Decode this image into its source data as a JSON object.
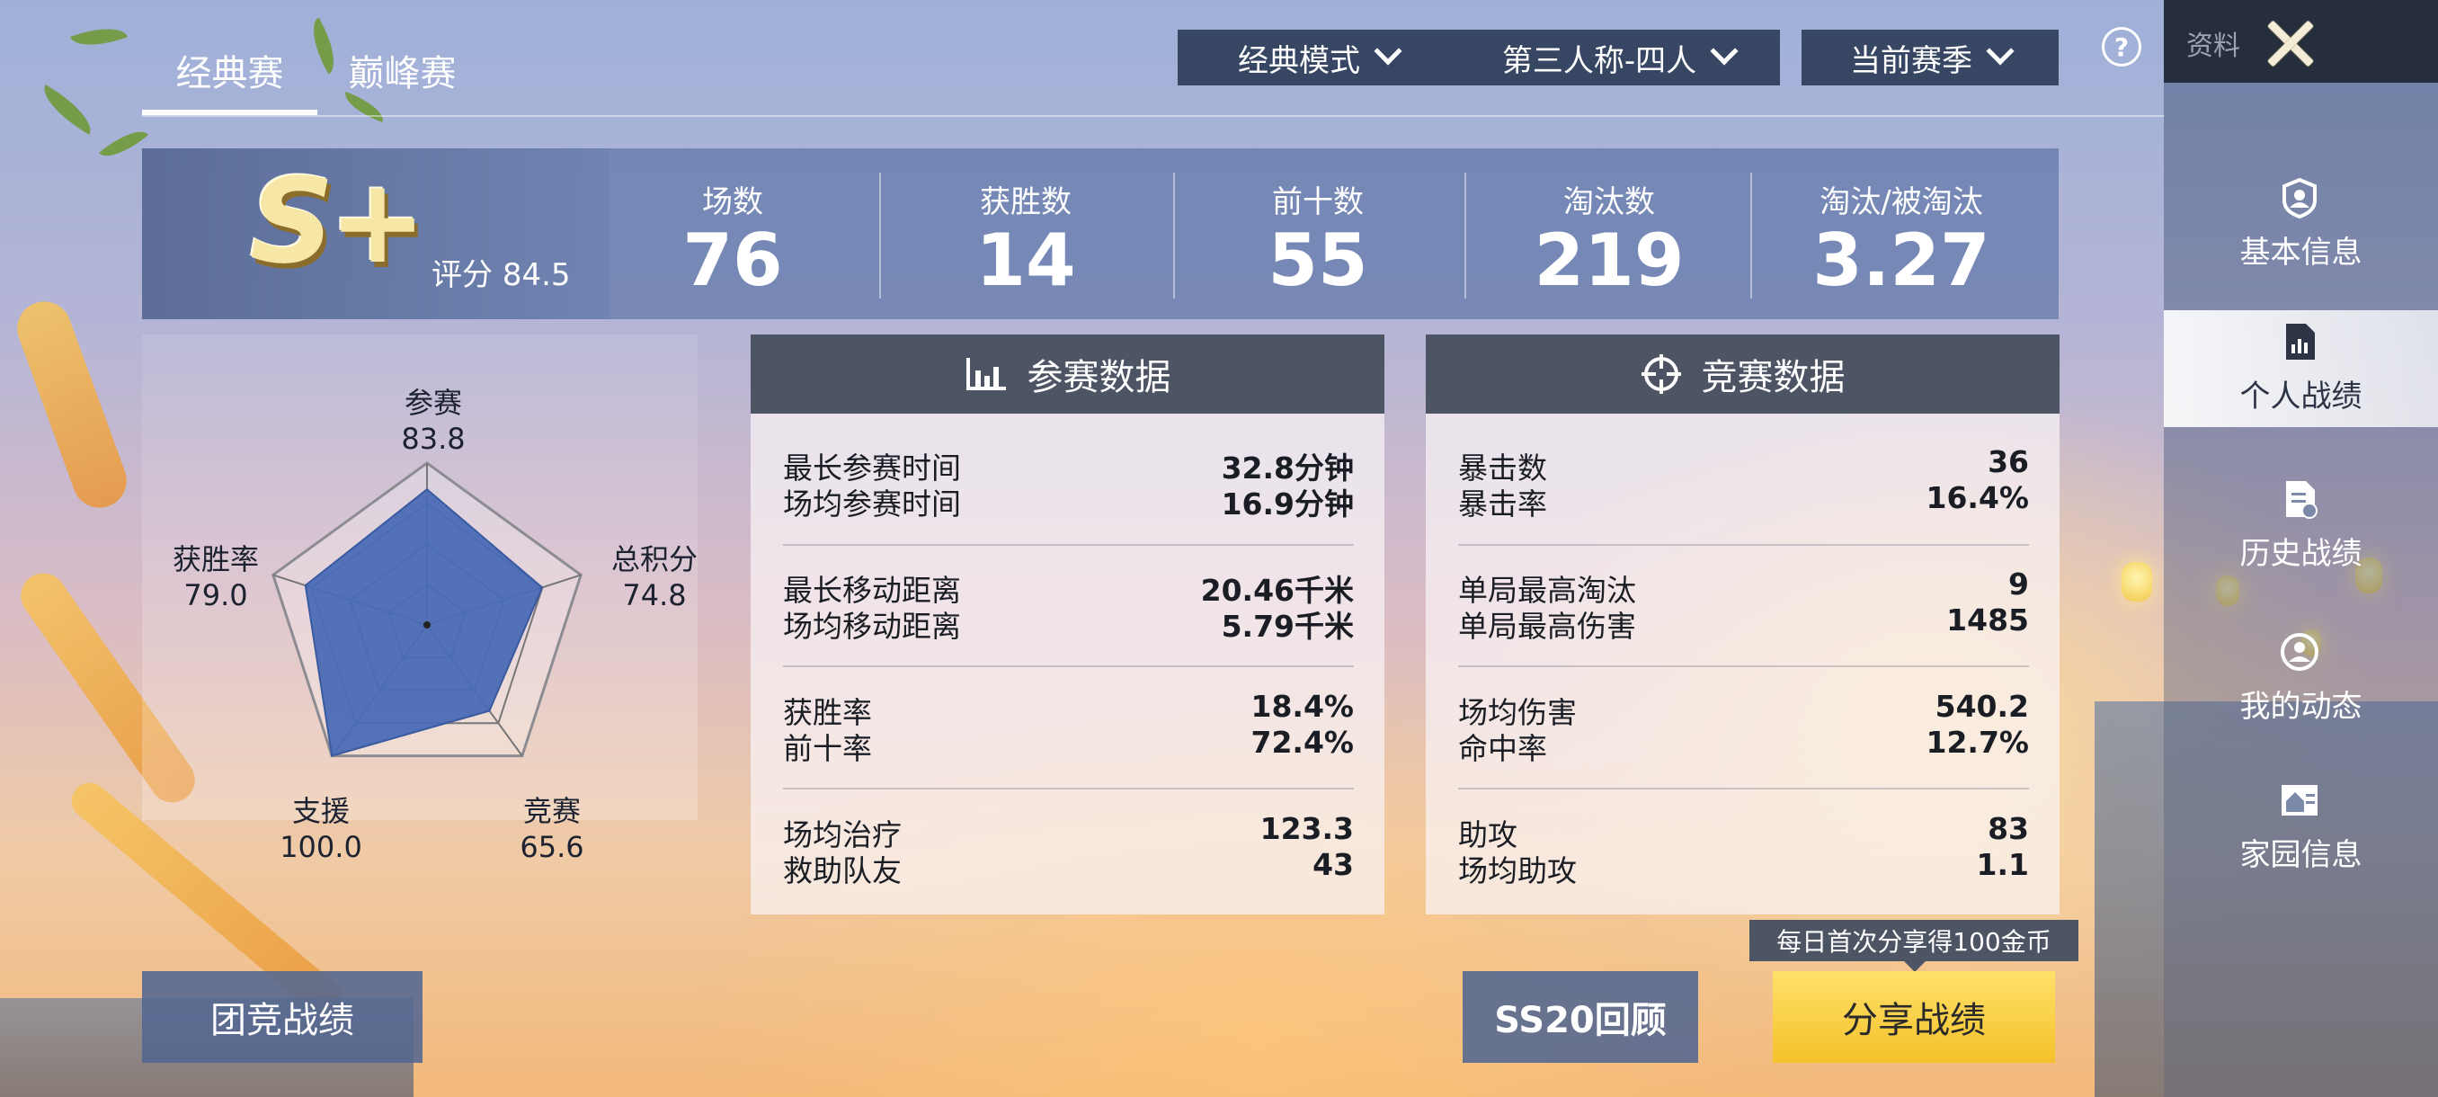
{
  "tabs": [
    {
      "label": "经典赛",
      "active": true
    },
    {
      "label": "巅峰赛",
      "active": false
    }
  ],
  "filters": {
    "mode": "经典模式",
    "perspective": "第三人称-四人",
    "season": "当前赛季"
  },
  "sidebar": {
    "title": "资料",
    "items": [
      {
        "label": "基本信息",
        "icon": "user-badge-icon",
        "active": false
      },
      {
        "label": "个人战绩",
        "icon": "stats-doc-icon",
        "active": true
      },
      {
        "label": "历史战绩",
        "icon": "history-doc-icon",
        "active": false
      },
      {
        "label": "我的动态",
        "icon": "activity-icon",
        "active": false
      },
      {
        "label": "家园信息",
        "icon": "home-icon",
        "active": false
      }
    ]
  },
  "summary": {
    "grade": "S+",
    "score_label": "评分",
    "score": "84.5",
    "stats": [
      {
        "label": "场数",
        "value": "76"
      },
      {
        "label": "获胜数",
        "value": "14"
      },
      {
        "label": "前十数",
        "value": "55"
      },
      {
        "label": "淘汰数",
        "value": "219"
      },
      {
        "label": "淘汰/被淘汰",
        "value": "3.27"
      }
    ]
  },
  "radar": {
    "axes": [
      {
        "label": "参赛",
        "value": "83.8",
        "score": 83.8
      },
      {
        "label": "总积分",
        "value": "74.8",
        "score": 74.8
      },
      {
        "label": "竞赛",
        "value": "65.6",
        "score": 65.6
      },
      {
        "label": "支援",
        "value": "100.0",
        "score": 100.0
      },
      {
        "label": "获胜率",
        "value": "79.0",
        "score": 79.0
      }
    ],
    "fill_color": "#4a6cb5"
  },
  "participation": {
    "title": "参赛数据",
    "groups": [
      [
        {
          "k": "最长参赛时间",
          "v": "32.8分钟"
        },
        {
          "k": "场均参赛时间",
          "v": "16.9分钟"
        }
      ],
      [
        {
          "k": "最长移动距离",
          "v": "20.46千米"
        },
        {
          "k": "场均移动距离",
          "v": "5.79千米"
        }
      ],
      [
        {
          "k": "获胜率",
          "v": "18.4%"
        },
        {
          "k": "前十率",
          "v": "72.4%"
        }
      ],
      [
        {
          "k": "场均治疗",
          "v": "123.3"
        },
        {
          "k": "救助队友",
          "v": "43"
        }
      ]
    ]
  },
  "competition": {
    "title": "竞赛数据",
    "groups": [
      [
        {
          "k": "暴击数",
          "v": "36"
        },
        {
          "k": "暴击率",
          "v": "16.4%"
        }
      ],
      [
        {
          "k": "单局最高淘汰",
          "v": "9"
        },
        {
          "k": "单局最高伤害",
          "v": "1485"
        }
      ],
      [
        {
          "k": "场均伤害",
          "v": "540.2"
        },
        {
          "k": "命中率",
          "v": "12.7%"
        }
      ],
      [
        {
          "k": "助攻",
          "v": "83"
        },
        {
          "k": "场均助攻",
          "v": "1.1"
        }
      ]
    ]
  },
  "buttons": {
    "team": "团竞战绩",
    "review": "SS20回顾",
    "share": "分享战绩",
    "share_tip": "每日首次分享得100金币"
  },
  "colors": {
    "accent_yellow": "#f4c12a",
    "panel_header": "#4d5464",
    "summary_bg": "#6c80af"
  }
}
